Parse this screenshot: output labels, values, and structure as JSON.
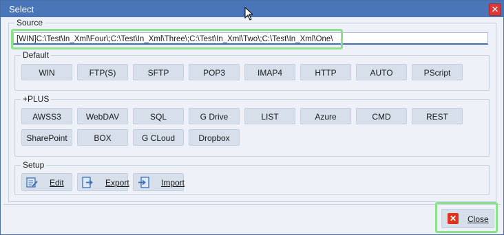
{
  "window": {
    "title": "Select",
    "close_glyph": "✕"
  },
  "source": {
    "label": "Source",
    "value": "[WIN]C:\\Test\\In_Xml\\Four\\;C:\\Test\\In_Xml\\Three\\;C:\\Test\\In_Xml\\Two\\;C:\\Test\\In_Xml\\One\\"
  },
  "default_group": {
    "label": "Default",
    "buttons": [
      "WIN",
      "FTP(S)",
      "SFTP",
      "POP3",
      "IMAP4",
      "HTTP",
      "AUTO",
      "PScript"
    ]
  },
  "plus_group": {
    "label": "+PLUS",
    "buttons": [
      "AWSS3",
      "WebDAV",
      "SQL",
      "G Drive",
      "LIST",
      "Azure",
      "CMD",
      "REST",
      "SharePoint",
      "BOX",
      "G CLoud",
      "Dropbox"
    ]
  },
  "setup_group": {
    "label": "Setup",
    "buttons": [
      {
        "label": "Edit",
        "icon": "edit-icon"
      },
      {
        "label": "Export",
        "icon": "export-icon"
      },
      {
        "label": "Import",
        "icon": "import-icon"
      }
    ]
  },
  "footer": {
    "close_label": "Close",
    "close_icon": "close-icon"
  },
  "colors": {
    "titlebar": "#4876b8",
    "button_face": "#d7dfeb",
    "highlight": "#8be28b",
    "close_red": "#e0331d"
  }
}
